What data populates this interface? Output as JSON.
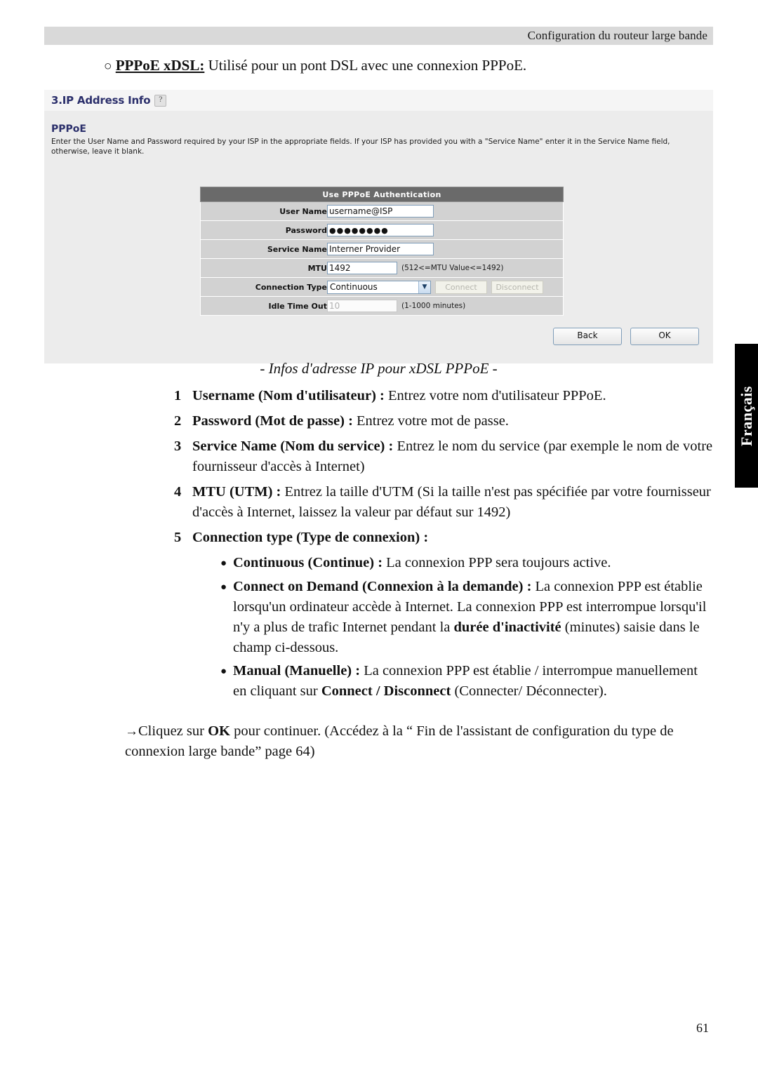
{
  "running_header": {
    "text": "Configuration du routeur large bande"
  },
  "intro": {
    "bullet": "○",
    "term": "PPPoE xDSL:",
    "rest": " Utilisé pour un pont DSL avec une connexion PPPoE."
  },
  "panel": {
    "header_title": "3.IP Address Info",
    "help_icon": "?",
    "section_title": "PPPoE",
    "section_text": "Enter the User Name and Password required by your ISP in the appropriate fields. If your ISP has provided you with a \"Service Name\" enter it in the Service Name field, otherwise, leave it blank.",
    "form": {
      "header": "Use PPPoE Authentication",
      "rows": [
        {
          "label": "User Name",
          "value": "username@ISP",
          "hint": ""
        },
        {
          "label": "Password",
          "value": "●●●●●●●●",
          "hint": ""
        },
        {
          "label": "Service Name",
          "value": "Interner Provider",
          "hint": ""
        },
        {
          "label": "MTU",
          "value": "1492",
          "hint": "(512<=MTU Value<=1492)"
        },
        {
          "label": "Connection Type",
          "value": "Continuous",
          "hint": ""
        },
        {
          "label": "Idle Time Out",
          "value": "10",
          "hint": "(1-1000 minutes)"
        }
      ],
      "connect_button": "Connect",
      "disconnect_button": "Disconnect",
      "dropdown_arrow": "▼"
    },
    "back_button": "Back",
    "ok_button": "OK"
  },
  "caption": "- Infos d'adresse IP pour xDSL PPPoE -",
  "steps": [
    {
      "num": "1",
      "bold": "Username (Nom d'utilisateur) :",
      "text": " Entrez votre nom d'utilisateur PPPoE."
    },
    {
      "num": "2",
      "bold": "Password (Mot de passe) :",
      "text": " Entrez votre mot de passe."
    },
    {
      "num": "3",
      "bold": "Service Name (Nom du service) :",
      "text": " Entrez le nom du service (par exemple le nom de votre fournisseur d'accès à Internet)"
    },
    {
      "num": "4",
      "bold": "MTU (UTM) :",
      "text": " Entrez la taille d'UTM (Si la taille n'est pas spécifiée par votre fournisseur d'accès à Internet, laissez la valeur par défaut sur 1492)"
    },
    {
      "num": "5",
      "bold": "Connection type (Type de connexion) :",
      "text": ""
    }
  ],
  "bullets": [
    {
      "dot": "●",
      "bold": "Continuous (Continue) :",
      "text": " La connexion PPP sera toujours active."
    },
    {
      "dot": "●",
      "bold": "Connect on Demand (Connexion à la demande) :",
      "text": " La connexion PPP est établie lorsqu'un ordinateur accède à Internet. La connexion PPP est interrompue lorsqu'il n'y a plus de trafic Internet pendant la ",
      "bold2": "durée d'inactivité",
      "text2": " (minutes) saisie dans le champ ci-dessous."
    },
    {
      "dot": "●",
      "bold": "Manual (Manuelle) :",
      "text": " La connexion PPP est établie / interrompue manuellement en cliquant sur ",
      "bold2": "Connect / Disconnect",
      "text2": " (Connecter/ Déconnecter)."
    }
  ],
  "final": {
    "arrow": "→",
    "pre": "Cliquez sur ",
    "bold": "OK",
    "post": " pour continuer. (Accédez à la “ Fin de l'assistant de configuration du type de connexion large bande” page 64)"
  },
  "language_tab": {
    "label": "Français"
  },
  "page_number": "61"
}
